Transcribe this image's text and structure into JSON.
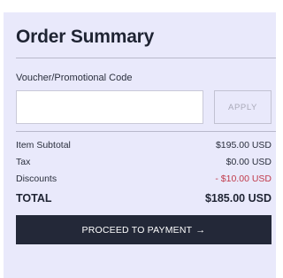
{
  "summary": {
    "title": "Order Summary",
    "voucher_label": "Voucher/Promotional Code",
    "voucher_value": "",
    "apply_label": "APPLY",
    "lines": {
      "subtotal": {
        "label": "Item Subtotal",
        "value": "$195.00 USD"
      },
      "tax": {
        "label": "Tax",
        "value": "$0.00 USD"
      },
      "discounts": {
        "label": "Discounts",
        "value": "- $10.00 USD"
      },
      "total": {
        "label": "TOTAL",
        "value": "$185.00 USD"
      }
    },
    "proceed_label": "PROCEED TO PAYMENT",
    "proceed_icon": "→"
  },
  "colors": {
    "card_background": "#e9e9fb",
    "button_background": "#232838",
    "discount_text": "#c0394a",
    "apply_text": "#a9a9b8"
  }
}
